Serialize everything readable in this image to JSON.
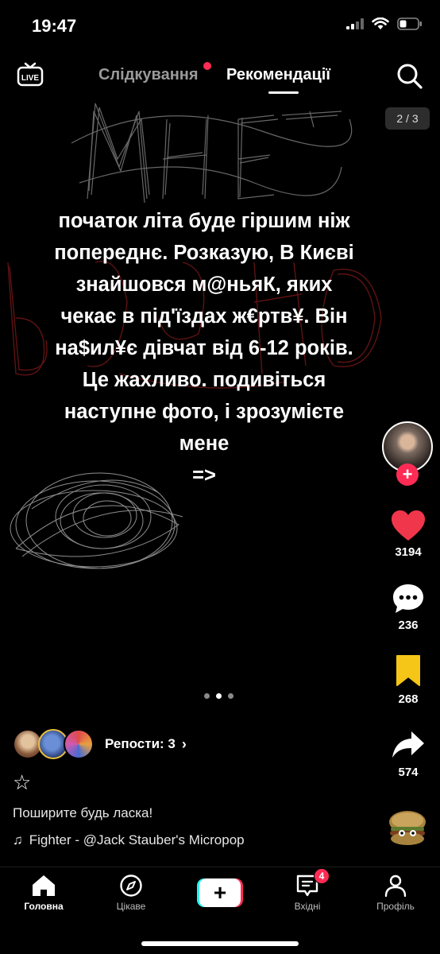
{
  "status_bar": {
    "time": "19:47",
    "icons": [
      "cellular-signal-icon",
      "wifi-icon",
      "battery-icon"
    ]
  },
  "top_nav": {
    "live_label": "LIVE",
    "following_label": "Слідкування",
    "foryou_label": "Рекомендації",
    "active_tab": "Рекомендації",
    "page_counter": "2 / 3"
  },
  "post": {
    "text": "початок літа буде гіршим ніж\nпопереднє. Розказую, В Києві\nзнайшовся  м@ньяК, яких\nчекає в під'їздах ж€ртв¥. Він\nна$ил¥є дівчат від 6-12 років.\nЦе жахливо. подивіться\nнаступне фото, і зрозумієте\nмене\n=>",
    "scribble_text_1": "МНЕ",
    "scribble_text_2": "БОЛЬНО",
    "carousel": {
      "total": 3,
      "active_index": 1
    }
  },
  "rail": {
    "likes": "3194",
    "comments": "236",
    "saves": "268",
    "shares": "574",
    "follow_symbol": "+"
  },
  "info": {
    "reposts_label": "Репости: 3",
    "reposts_chevron": "›",
    "star": "☆",
    "caption": "Поширите будь ласка!",
    "music_note": "♫",
    "music": "Fighter - @Jack Stauber's Micropop"
  },
  "tabbar": {
    "home": "Головна",
    "discover": "Цікаве",
    "inbox": "Вхідні",
    "inbox_badge": "4",
    "profile": "Профіль",
    "create_symbol": "+"
  },
  "colors": {
    "accent": "#fe2c55",
    "heart": "#f0364a",
    "bookmark": "#f5c518",
    "scribble_red": "#7a1a1a"
  }
}
